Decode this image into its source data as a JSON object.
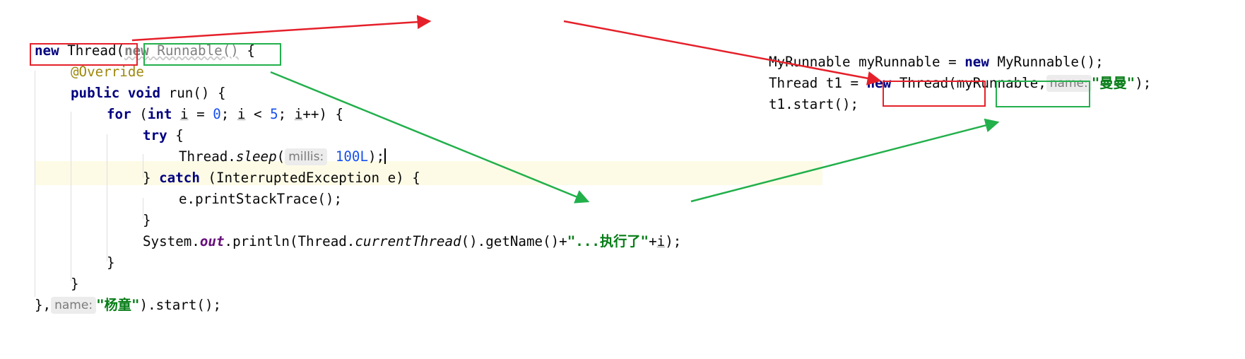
{
  "left_code": {
    "l1_new": "new",
    "l1_thread": " Thread(",
    "l1_new2": "new",
    "l1_runnable": " Runnable()",
    "l1_brace": " {",
    "l2_override": "@Override",
    "l3_public": "public",
    "l3_void": "void",
    "l3_run": " run() {",
    "l4_for": "for",
    "l4_paren": " (",
    "l4_int": "int",
    "l4_i1": "i",
    "l4_eq": " = ",
    "l4_zero": "0",
    "l4_semi1": "; ",
    "l4_i2": "i",
    "l4_lt": " < ",
    "l4_five": "5",
    "l4_semi2": "; ",
    "l4_i3": "i",
    "l4_end": "++) {",
    "l5_try": "try",
    "l5_brace": " {",
    "l6_thread": "Thread.",
    "l6_sleep": "sleep",
    "l6_open": "(",
    "l6_hint": "millis:",
    "l6_val": "100L",
    "l6_end": ");",
    "l7_close": "} ",
    "l7_catch": "catch",
    "l7_rest": " (InterruptedException e) {",
    "l8_trace": "e.printStackTrace();",
    "l9_close": "}",
    "l10_system": "System.",
    "l10_out": "out",
    "l10_println": ".println(Thread.",
    "l10_current": "currentThread",
    "l10_getname": "().getName()+",
    "l10_str": "\"...执行了\"",
    "l10_plus": "+",
    "l10_i": "i",
    "l10_end": ");",
    "l11_close": "}",
    "l12_close": "}",
    "l13_start": "},",
    "l13_hint": "name:",
    "l13_str": "\"杨童\"",
    "l13_end": ").start();"
  },
  "right_code": {
    "r1_decl": "MyRunnable myRunnable = ",
    "r1_new": "new",
    "r1_ctor": " MyRunnable();",
    "r2_decl": "Thread t1 = ",
    "r2_new": "new",
    "r2_thread": " Thread(",
    "r2_arg": "myRunnable,",
    "r2_hint": "name:",
    "r2_str": "\"曼曼\"",
    "r2_end": ");",
    "r3_start": "t1.start();"
  },
  "colors": {
    "keyword": "#000080",
    "annotation": "#9e880d",
    "number": "#1750eb",
    "string": "#067d17",
    "static_field": "#660e7a",
    "red_marker": "#e5202a",
    "green_marker": "#22b04b",
    "line_highlight": "#fdfbe6"
  }
}
